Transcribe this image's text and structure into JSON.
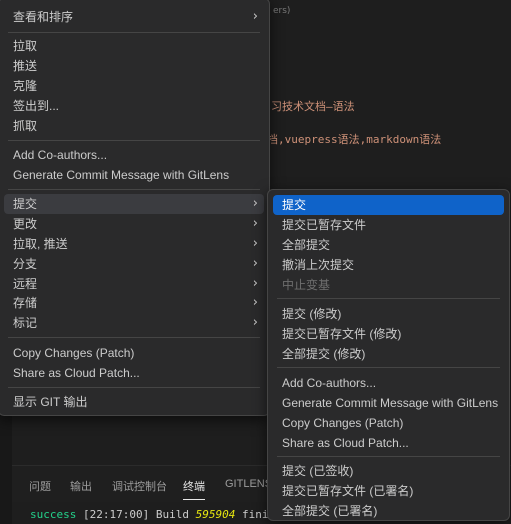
{
  "editor": {
    "line1": "ers)",
    "line2": "习技术文档—语法",
    "line3": "档,vuepress语法,markdown语法"
  },
  "panel": {
    "tabs": [
      "问题",
      "输出",
      "调试控制台",
      "终端",
      "GITLENS"
    ],
    "active_tab": "终端",
    "terminal": {
      "status": "success",
      "time": "[22:17:00]",
      "text_before": "Build",
      "build_id": "595904",
      "text_after": "finish"
    }
  },
  "main_menu": {
    "items": [
      {
        "label": "查看和排序",
        "submenu": true
      },
      {
        "label": "拉取"
      },
      {
        "label": "推送"
      },
      {
        "label": "克隆"
      },
      {
        "label": "签出到..."
      },
      {
        "label": "抓取"
      },
      {
        "label": "Add Co-authors..."
      },
      {
        "label": "Generate Commit Message with GitLens"
      },
      {
        "label": "提交",
        "submenu": true,
        "highlighted": true
      },
      {
        "label": "更改",
        "submenu": true
      },
      {
        "label": "拉取, 推送",
        "submenu": true
      },
      {
        "label": "分支",
        "submenu": true
      },
      {
        "label": "远程",
        "submenu": true
      },
      {
        "label": "存储",
        "submenu": true
      },
      {
        "label": "标记",
        "submenu": true
      },
      {
        "label": "Copy Changes (Patch)"
      },
      {
        "label": "Share as Cloud Patch..."
      },
      {
        "label": "显示 GIT 输出"
      }
    ]
  },
  "commit_submenu": {
    "items": [
      {
        "label": "提交",
        "selected": true
      },
      {
        "label": "提交已暂存文件"
      },
      {
        "label": "全部提交"
      },
      {
        "label": "撤消上次提交"
      },
      {
        "label": "中止变基",
        "disabled": true
      },
      {
        "label": "提交 (修改)"
      },
      {
        "label": "提交已暂存文件 (修改)"
      },
      {
        "label": "全部提交 (修改)"
      },
      {
        "label": "Add Co-authors..."
      },
      {
        "label": "Generate Commit Message with GitLens"
      },
      {
        "label": "Copy Changes (Patch)"
      },
      {
        "label": "Share as Cloud Patch..."
      },
      {
        "label": "提交 (已签收)"
      },
      {
        "label": "提交已暂存文件 (已署名)"
      },
      {
        "label": "全部提交 (已署名)"
      }
    ]
  },
  "icons": {
    "submenu_arrow": "chevron-right-icon"
  },
  "colors": {
    "selection": "#0f63c9",
    "menu_bg": "#2a2a2b"
  }
}
